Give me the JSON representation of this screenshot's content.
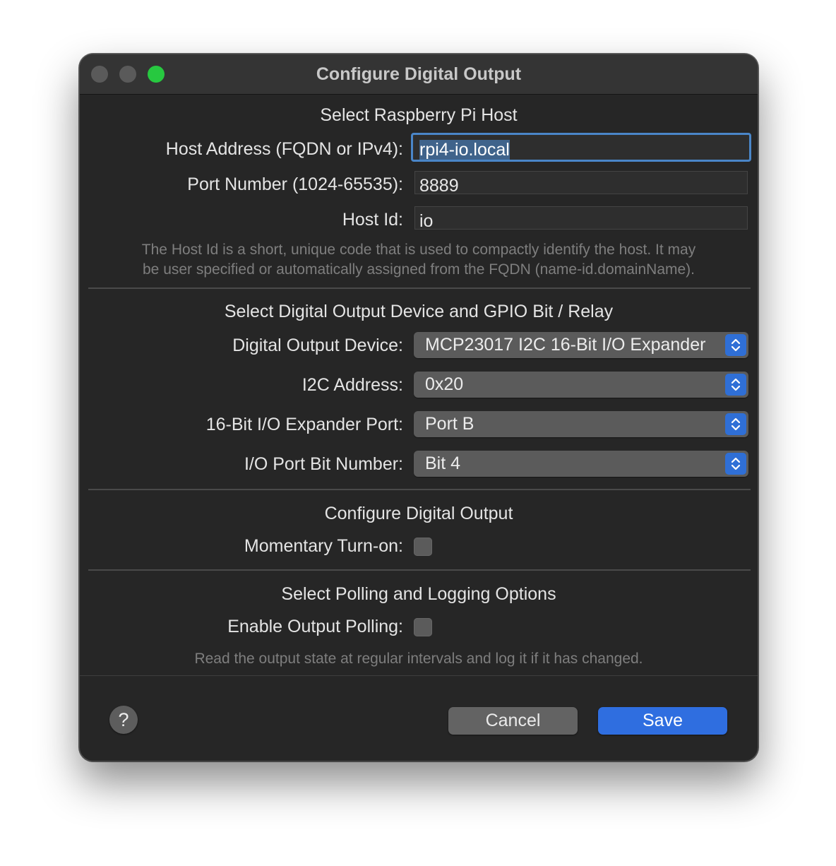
{
  "window": {
    "title": "Configure Digital Output",
    "accent_color": "#2f6ee0"
  },
  "host_section": {
    "title": "Select Raspberry Pi Host",
    "host_address_label": "Host Address (FQDN or IPv4):",
    "host_address_value": "rpi4-io.local",
    "port_label": "Port Number (1024-65535):",
    "port_value": "8889",
    "host_id_label": "Host Id:",
    "host_id_value": "io",
    "hint_line1": "The Host Id is a short, unique code that is used to compactly identify the host.  It may",
    "hint_line2": "be user specified or automatically assigned from the FQDN (name-id.domainName)."
  },
  "device_section": {
    "title": "Select Digital Output Device and GPIO Bit / Relay",
    "device_label": "Digital Output Device:",
    "device_value": "MCP23017 I2C 16-Bit I/O Expander",
    "i2c_label": "I2C Address:",
    "i2c_value": "0x20",
    "port_label": "16-Bit I/O Expander Port:",
    "port_value": "Port B",
    "bit_label": "I/O Port Bit Number:",
    "bit_value": "Bit 4"
  },
  "output_section": {
    "title": "Configure Digital Output",
    "momentary_label": "Momentary Turn-on:",
    "momentary_checked": false
  },
  "polling_section": {
    "title": "Select Polling and Logging Options",
    "polling_label": "Enable Output Polling:",
    "polling_checked": false,
    "hint": "Read the output state at regular intervals and log it if it has changed."
  },
  "footer": {
    "help_label": "?",
    "cancel_label": "Cancel",
    "save_label": "Save"
  }
}
